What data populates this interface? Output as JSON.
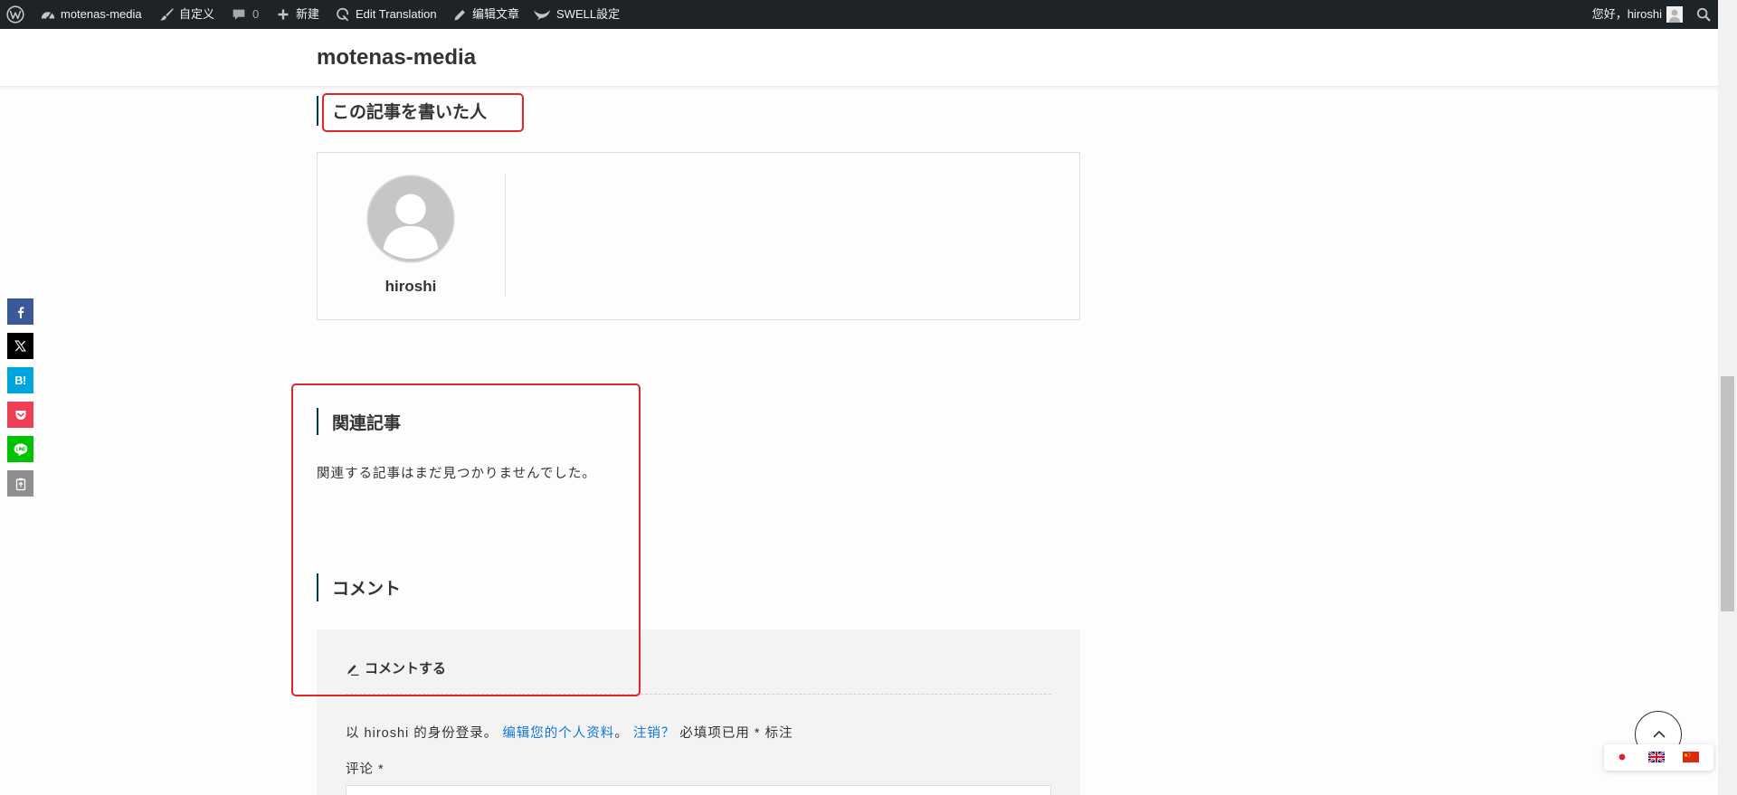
{
  "admin_bar": {
    "wp_logo_icon": "wordpress-logo-icon",
    "site_icon": "dashboard-icon",
    "site_name": "motenas-media",
    "customize_icon": "brush-icon",
    "customize": "自定义",
    "comments_icon": "comment-bubble-icon",
    "comments_count": "0",
    "new_icon": "plus-icon",
    "new_content": "新建",
    "edit_translation_icon": "translate-icon",
    "edit_translation": "Edit Translation",
    "edit_post_icon": "pencil-icon",
    "edit_post": "编辑文章",
    "swell_icon": "swell-bird-icon",
    "swell_settings": "SWELL設定",
    "greeting": "您好，hiroshi",
    "avatar_icon": "user-avatar-icon",
    "search_icon": "search-icon"
  },
  "header": {
    "site_title": "motenas-media"
  },
  "author_box": {
    "heading": "この記事を書いた人",
    "avatar_icon": "default-avatar-icon",
    "author_name": "hiroshi"
  },
  "share_bar": {
    "buttons": [
      {
        "icon": "facebook-icon"
      },
      {
        "icon": "x-icon"
      },
      {
        "icon": "hatena-bookmark-icon",
        "label": "B!"
      },
      {
        "icon": "pocket-icon"
      },
      {
        "icon": "line-icon"
      },
      {
        "icon": "copy-url-icon"
      }
    ]
  },
  "related_posts": {
    "heading": "関連記事",
    "empty_message": "関連する記事はまだ見つかりませんでした。"
  },
  "comments": {
    "heading": "コメント",
    "form_icon": "pen-icon",
    "form_title": "コメントする",
    "logged_in_as": "以 hiroshi 的身份登录。",
    "edit_profile_link": "编辑您的个人资料",
    "sentence_end": "。",
    "logout_link": "注销？",
    "required_note": "必填项已用 * 标注",
    "comment_label": "评论 *"
  },
  "floating": {
    "back_to_top_icon": "chevron-up-icon",
    "languages": [
      {
        "icon": "japan-flag-icon"
      },
      {
        "icon": "uk-flag-icon"
      },
      {
        "icon": "china-flag-icon"
      }
    ]
  },
  "colors": {
    "admin_bar": "#1d2327",
    "accent": "#04384c",
    "link": "#1176d4",
    "highlight": "#e0262b",
    "facebook": "#3b5998",
    "x": "#000000",
    "hatena": "#00a4de",
    "pocket": "#ef3f56",
    "line": "#00c300",
    "copy": "#8e8e8e"
  }
}
